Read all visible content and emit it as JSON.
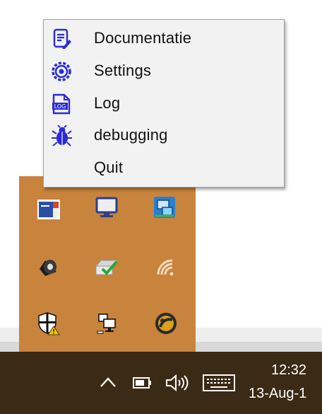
{
  "context_menu": {
    "items": [
      {
        "label": "Documentatie",
        "icon": "document-edit-icon"
      },
      {
        "label": "Settings",
        "icon": "gear-icon"
      },
      {
        "label": "Log",
        "icon": "log-file-icon"
      },
      {
        "label": "debugging",
        "icon": "bug-icon"
      },
      {
        "label": "Quit",
        "icon": ""
      }
    ]
  },
  "tray_overflow": {
    "icons": [
      "app-logo-icon",
      "monitor-icon",
      "network-tool-icon",
      "speaker-icon",
      "printer-check-icon",
      "wifi-icon",
      "security-shield-warning-icon",
      "network-computer-icon",
      "sync-globe-icon"
    ]
  },
  "taskbar": {
    "clock_time": "12:32",
    "clock_date": "13-Aug-1",
    "icons": [
      "show-hidden-icons-chevron-icon",
      "battery-icon",
      "volume-icon",
      "keyboard-icon"
    ]
  },
  "colors": {
    "menu_icon": "#2b2bd6",
    "flyout_bg": "#c8833c",
    "taskbar_bg": "#3b2a16",
    "menu_bg": "#f2f2f2"
  }
}
